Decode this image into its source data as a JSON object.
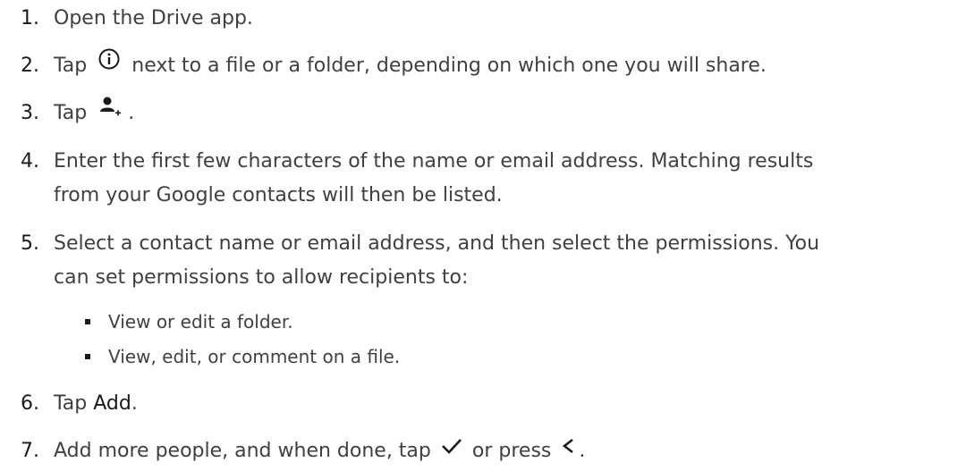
{
  "steps": [
    {
      "num": "1.",
      "text": "Open the Drive app."
    },
    {
      "num": "2.",
      "before": "Tap",
      "icon": "info-circle-icon",
      "after": "next to a file or a folder, depending on which one you will share."
    },
    {
      "num": "3.",
      "before": "Tap",
      "icon": "add-person-icon",
      "after": "."
    },
    {
      "num": "4.",
      "line1": "Enter the first few characters of the name or email address. Matching results",
      "line2": "from your Google contacts will then be listed."
    },
    {
      "num": "5.",
      "line1": "Select a contact name or email address, and then select the permissions. You",
      "line2": "can set permissions to allow recipients to:"
    },
    {
      "num": "6.",
      "before": "Tap",
      "bold": "Add",
      "after": "."
    },
    {
      "num": "7.",
      "before": "Add more people, and when done, tap",
      "icon1": "checkmark-icon",
      "middle": "or press",
      "icon2": "back-chevron-icon",
      "after": "."
    }
  ],
  "bullets": [
    "View or edit a folder.",
    "View, edit, or comment on a file."
  ]
}
